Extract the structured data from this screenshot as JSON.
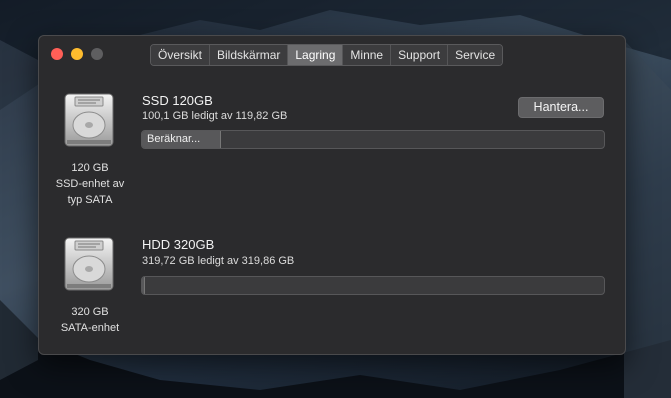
{
  "tabs": [
    "Översikt",
    "Bildskärmar",
    "Lagring",
    "Minne",
    "Support",
    "Service"
  ],
  "active_tab": "Lagring",
  "disks": [
    {
      "icon": "hard-drive-icon",
      "label_line1": "120 GB",
      "label_line2": "SSD-enhet av",
      "label_line3": "typ SATA",
      "name": "SSD 120GB",
      "free_text": "100,1 GB ledigt av 119,82 GB",
      "bar_text": "Beräknar...",
      "used_fraction": 0.17,
      "manage_button": "Hantera..."
    },
    {
      "icon": "hard-drive-icon",
      "label_line1": "320 GB",
      "label_line2": "SATA-enhet",
      "name": "HDD 320GB",
      "free_text": "319,72 GB ledigt av 319,86 GB",
      "used_fraction": 0.004
    }
  ],
  "colors": {
    "window_bg": "#2b2b2d",
    "close": "#ff5f57",
    "minimize": "#febc2e",
    "zoom_disabled": "#5e5e60"
  }
}
